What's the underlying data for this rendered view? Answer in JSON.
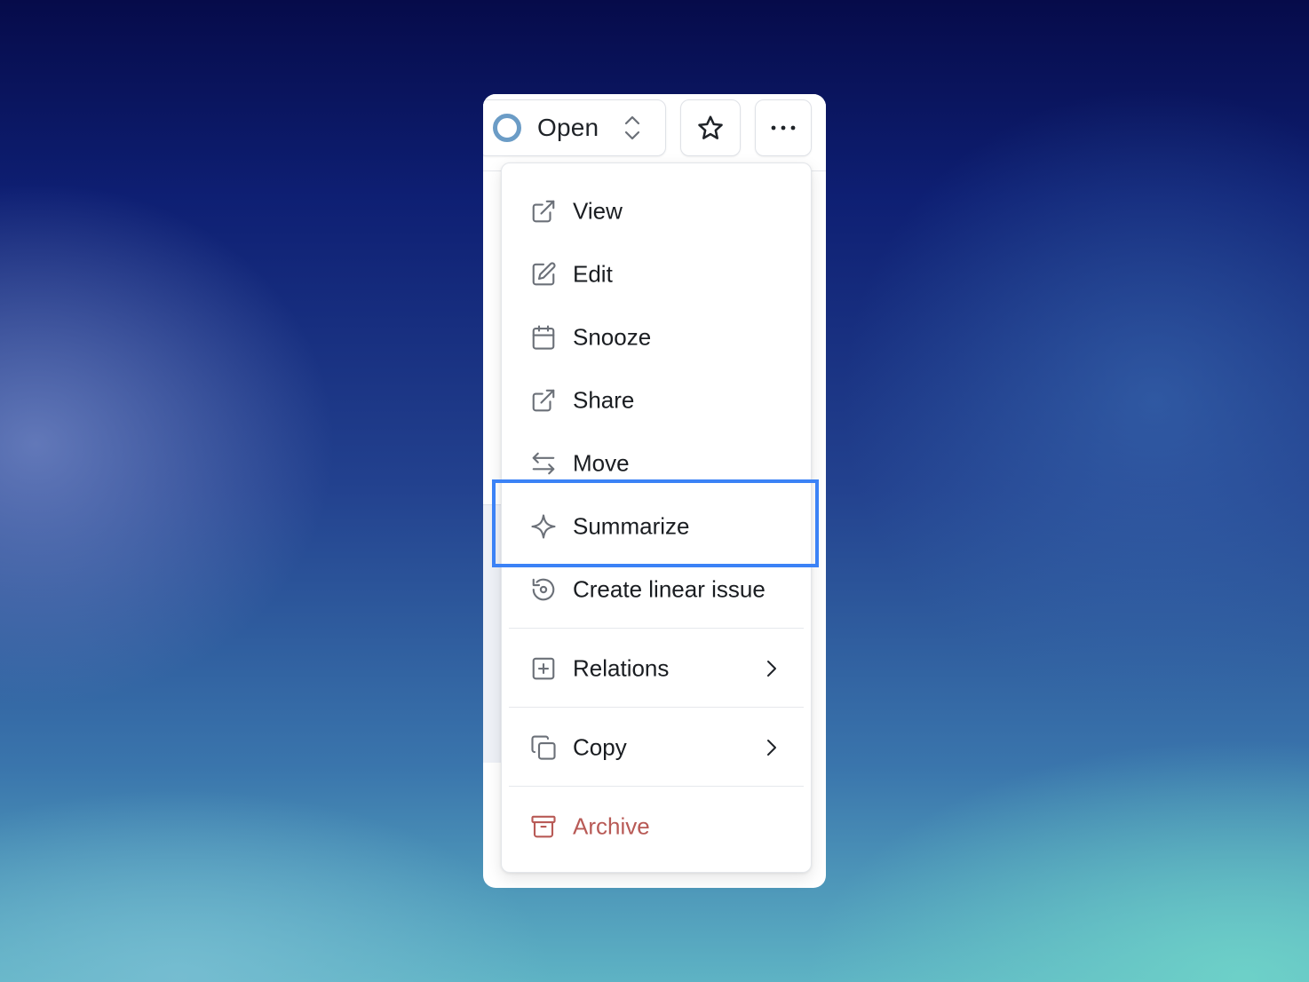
{
  "toolbar": {
    "status_label": "Open",
    "status_icon": "open-circle-icon",
    "star_icon": "star-icon",
    "more_icon": "ellipsis-icon"
  },
  "menu": {
    "items": [
      {
        "label": "View",
        "icon": "external-link-icon"
      },
      {
        "label": "Edit",
        "icon": "edit-icon"
      },
      {
        "label": "Snooze",
        "icon": "calendar-icon"
      },
      {
        "label": "Share",
        "icon": "share-icon"
      },
      {
        "label": "Move",
        "icon": "arrows-left-right-icon"
      },
      {
        "label": "Summarize",
        "icon": "sparkle-icon",
        "highlighted": true
      },
      {
        "label": "Create linear issue",
        "icon": "refresh-cycle-icon"
      },
      {
        "label": "Relations",
        "icon": "plus-square-icon",
        "has_submenu": true
      },
      {
        "label": "Copy",
        "icon": "copy-icon",
        "has_submenu": true
      },
      {
        "label": "Archive",
        "icon": "archive-icon",
        "danger": true
      }
    ]
  },
  "colors": {
    "highlight_border": "#3b82f6",
    "danger_text": "#b85a56",
    "status_ring": "#6b9cc6"
  }
}
